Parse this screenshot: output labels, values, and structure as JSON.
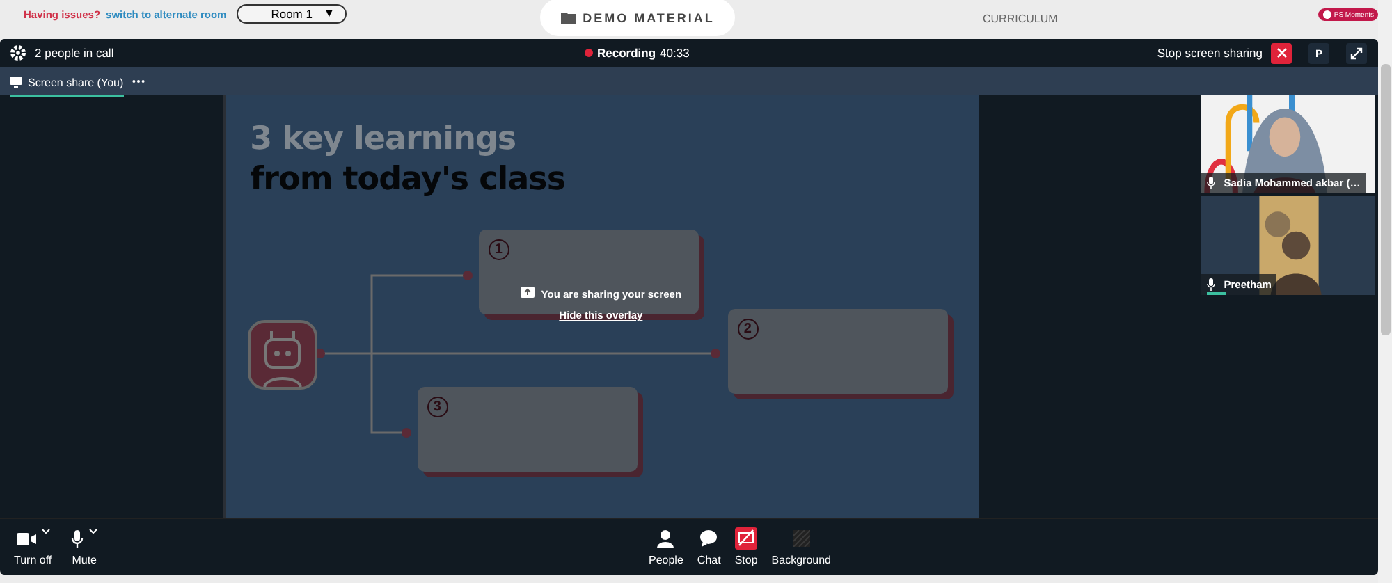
{
  "top_bar": {
    "issue_text": "Having issues?",
    "alternate_link": "switch to alternate room",
    "room_select": {
      "value": "Room 1",
      "caret": "▼"
    },
    "tabs": [
      {
        "label": "DEMO MATERIAL",
        "selected": true
      },
      {
        "label": "CURRICULUM",
        "selected": false
      }
    ],
    "badge": "PS Moments"
  },
  "call_header": {
    "people_count": "2 people in call",
    "recording": {
      "on": true,
      "label": "Recording",
      "time": "40:33"
    },
    "stop_sharing": "Stop screen sharing",
    "presenter_button": "P"
  },
  "share_tab": {
    "label": "Screen share (You)",
    "selected": true
  },
  "slide": {
    "title_lines": [
      "3 key learnings",
      "from today's class"
    ],
    "boxes": [
      {
        "number": "1"
      },
      {
        "number": "2"
      },
      {
        "number": "3"
      }
    ],
    "overlay": {
      "message": "You are sharing your screen",
      "hide_link": "Hide this overlay"
    }
  },
  "participants": [
    {
      "name": "Sadia Mohammed akbar (…",
      "speaking": false,
      "kind": "picture"
    },
    {
      "name": "Preetham",
      "speaking": true,
      "kind": "picture"
    }
  ],
  "controls_left": [
    {
      "kind": "camera",
      "label": "Turn off"
    },
    {
      "kind": "mic",
      "label": "Mute"
    }
  ],
  "controls_center": [
    {
      "kind": "people",
      "label": "People"
    },
    {
      "kind": "chat",
      "label": "Chat"
    },
    {
      "kind": "stop",
      "label": "Stop"
    },
    {
      "kind": "background",
      "label": "Background"
    }
  ]
}
